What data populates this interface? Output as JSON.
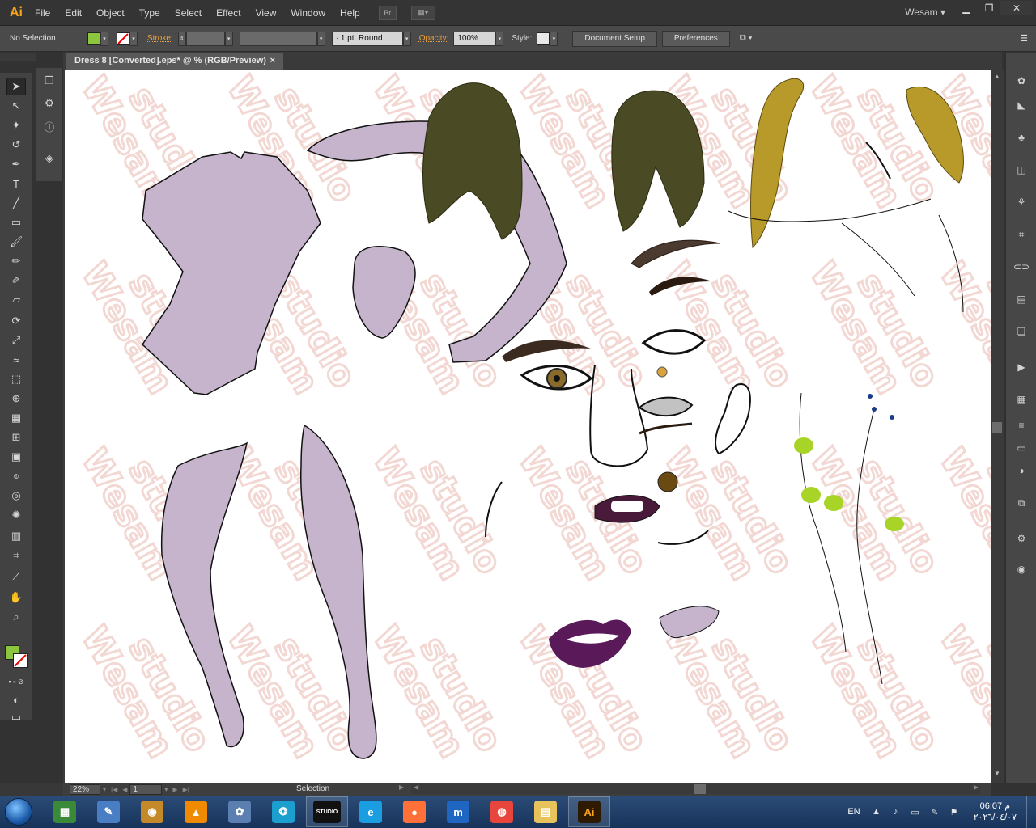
{
  "app": {
    "logo": "Ai",
    "menu": [
      "File",
      "Edit",
      "Object",
      "Type",
      "Select",
      "Effect",
      "View",
      "Window",
      "Help"
    ],
    "bridge_button": "Br",
    "user": "Wesam",
    "window_controls": [
      "minimize-icon",
      "restore-icon",
      "close-icon"
    ]
  },
  "controlbar": {
    "selection_state": "No Selection",
    "fill_color": "#8cc63f",
    "stroke_label": "Stroke:",
    "brush_value": "1 pt. Round",
    "opacity_label": "Opacity:",
    "opacity_value": "100%",
    "style_label": "Style:",
    "document_setup": "Document Setup",
    "preferences": "Preferences"
  },
  "document": {
    "tab_title": "Dress 8 [Converted].eps* @ % (RGB/Preview)",
    "tab_close": "×",
    "watermark_text": "Wesam studio"
  },
  "statusbar": {
    "zoom": "22%",
    "page": "1",
    "current_tool": "Selection"
  },
  "taskbar": {
    "apps": [
      {
        "name": "task-manager-app",
        "glyph": "▦",
        "color": "#3a8a3a"
      },
      {
        "name": "draw-app",
        "glyph": "✎",
        "color": "#4a7ec4"
      },
      {
        "name": "monitor-app",
        "glyph": "◉",
        "color": "#c48a2a"
      },
      {
        "name": "vlc-app",
        "glyph": "▲",
        "color": "#f08a00"
      },
      {
        "name": "tools-app",
        "glyph": "✿",
        "color": "#5a7fb0"
      },
      {
        "name": "media-app",
        "glyph": "❂",
        "color": "#1a9fcf"
      },
      {
        "name": "studio-app",
        "glyph": "STUDIO",
        "color": "#111111"
      },
      {
        "name": "edge-app",
        "glyph": "e",
        "color": "#1b9de2"
      },
      {
        "name": "firefox-app",
        "glyph": "●",
        "color": "#ff7139"
      },
      {
        "name": "m-app",
        "glyph": "m",
        "color": "#1f66c2"
      },
      {
        "name": "chrome-app",
        "glyph": "◍",
        "color": "#e8453c"
      },
      {
        "name": "explorer-app",
        "glyph": "▤",
        "color": "#e8c25a"
      },
      {
        "name": "illustrator-app",
        "glyph": "Ai",
        "color": "#2e1a00"
      }
    ],
    "language": "EN",
    "time": "06:07 م",
    "date": "٢٠٢٦/٠٤/٠٧"
  },
  "colors": {
    "accent": "#f7a21b",
    "skin": "#c5b4cb",
    "hair_dark": "#4a4a25",
    "hair_gold": "#b89a2a",
    "lips": "#5a1a5a"
  }
}
